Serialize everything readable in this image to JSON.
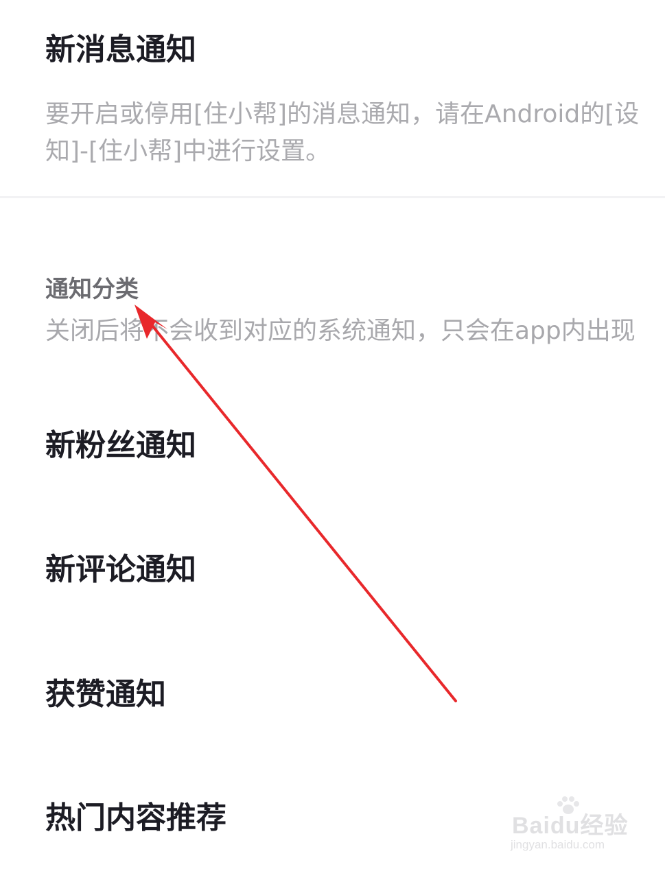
{
  "notification_header": {
    "title": "新消息通知",
    "description_line1": "要开启或停用[住小帮]的消息通知，请在Android的[设",
    "description_line2": "知]-[住小帮]中进行设置。"
  },
  "category": {
    "title": "通知分类",
    "description": "关闭后将不会收到对应的系统通知，只会在app内出现"
  },
  "settings": [
    {
      "label": "新粉丝通知"
    },
    {
      "label": "新评论通知"
    },
    {
      "label": "获赞通知"
    },
    {
      "label": "热门内容推荐"
    }
  ],
  "annotation": {
    "arrow_color": "#e8282b"
  },
  "watermark": {
    "logo": "Baidu经验",
    "url": "jingyan.baidu.com"
  }
}
